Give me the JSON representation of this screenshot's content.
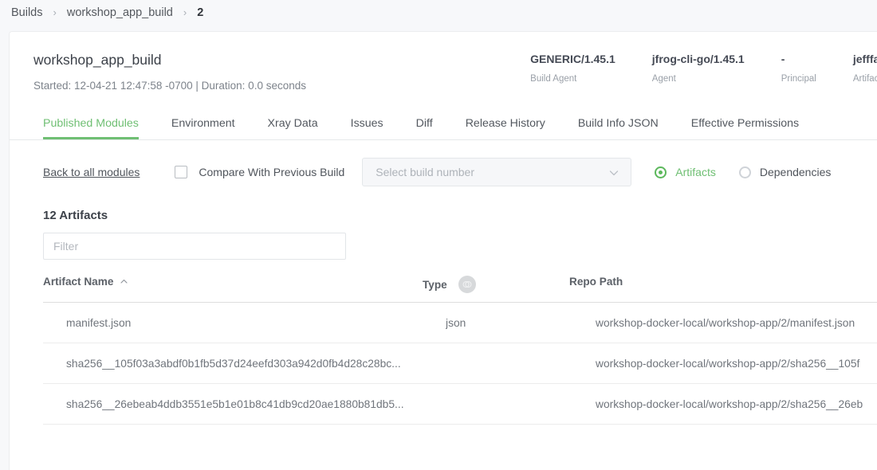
{
  "breadcrumb": {
    "separator": "›",
    "items": [
      {
        "label": "Builds"
      },
      {
        "label": "workshop_app_build"
      },
      {
        "label": "2"
      }
    ]
  },
  "build": {
    "title": "workshop_app_build",
    "subtitle": "Started: 12-04-21 12:47:58 -0700 | Duration: 0.0 seconds",
    "meta": [
      {
        "value": "GENERIC/1.45.1",
        "label": "Build Agent"
      },
      {
        "value": "jfrog-cli-go/1.45.1",
        "label": "Agent"
      },
      {
        "value": "-",
        "label": "Principal"
      },
      {
        "value": "jefffak",
        "label": "Artifacto"
      }
    ]
  },
  "tabs": [
    {
      "label": "Published Modules",
      "active": true
    },
    {
      "label": "Environment",
      "active": false
    },
    {
      "label": "Xray Data",
      "active": false
    },
    {
      "label": "Issues",
      "active": false
    },
    {
      "label": "Diff",
      "active": false
    },
    {
      "label": "Release History",
      "active": false
    },
    {
      "label": "Build Info JSON",
      "active": false
    },
    {
      "label": "Effective Permissions",
      "active": false
    }
  ],
  "controls": {
    "back_link": "Back to all modules",
    "compare_label": "Compare With Previous Build",
    "compare_checked": false,
    "build_select_placeholder": "Select build number",
    "radios": [
      {
        "label": "Artifacts",
        "selected": true
      },
      {
        "label": "Dependencies",
        "selected": false
      }
    ]
  },
  "artifacts": {
    "heading": "12 Artifacts",
    "filter_placeholder": "Filter",
    "filter_value": "",
    "columns": {
      "name": "Artifact Name",
      "type": "Type",
      "path": "Repo Path"
    },
    "sort": {
      "column": "Artifact Name",
      "direction": "asc"
    },
    "rows": [
      {
        "name": "manifest.json",
        "type": "json",
        "path": "workshop-docker-local/workshop-app/2/manifest.json"
      },
      {
        "name": "sha256__105f03a3abdf0b1fb5d37d24eefd303a942d0fb4d28c28bc...",
        "type": "",
        "path": "workshop-docker-local/workshop-app/2/sha256__105f"
      },
      {
        "name": "sha256__26ebeab4ddb3551e5b1e01b8c41db9cd20ae1880b81db5...",
        "type": "",
        "path": "workshop-docker-local/workshop-app/2/sha256__26eb"
      }
    ]
  },
  "colors": {
    "accent_green": "#6fbf73",
    "radio_green": "#5cb85c",
    "page_bg": "#f7f8fa",
    "card_bg": "#ffffff",
    "text": "#45494e",
    "muted": "#9aa0a8"
  }
}
